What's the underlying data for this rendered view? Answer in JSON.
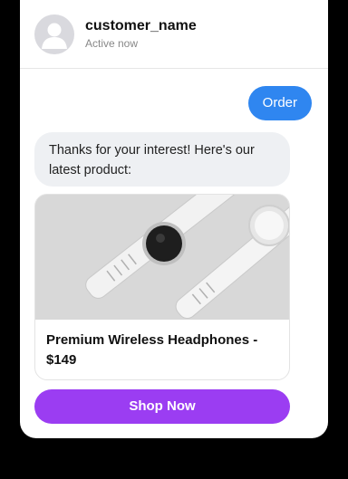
{
  "contact": {
    "name": "customer_name",
    "status": "Active now"
  },
  "messages": {
    "outgoing": "Order",
    "incoming": "Thanks for your interest! Here's our latest product:"
  },
  "product": {
    "title": "Premium Wireless Headphones - $149",
    "image_icon": "smartwatch-image"
  },
  "actions": {
    "shop_label": "Shop Now"
  },
  "colors": {
    "outgoing_bubble": "#2f86f0",
    "incoming_bubble": "#eef0f3",
    "shop_button": "#9b3df2",
    "background": "#000000"
  }
}
